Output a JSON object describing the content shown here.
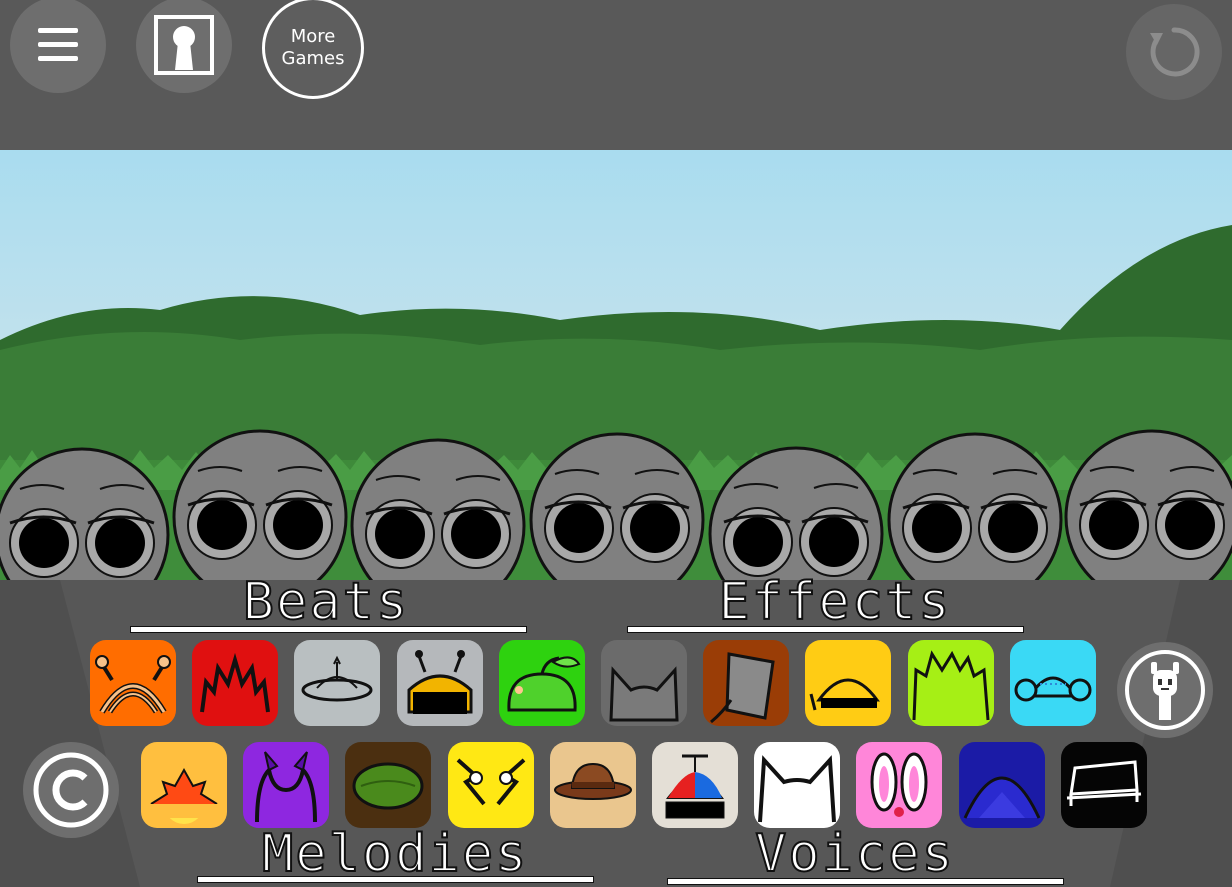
{
  "toolbar": {
    "menu_icon": "hamburger-menu-icon",
    "keyhole_icon": "keyhole-icon",
    "more_games_line1": "More",
    "more_games_line2": "Games",
    "reset_icon": "reset-icon"
  },
  "categories": {
    "beats": "Beats",
    "effects": "Effects",
    "melodies": "Melodies",
    "voices": "Voices"
  },
  "row1_slots": [
    {
      "icon": "orange-antenna-headband-icon",
      "color": "#ff6d00"
    },
    {
      "icon": "red-spiky-hair-icon",
      "color": "#e01010"
    },
    {
      "icon": "grey-ufo-icon",
      "color": "#b9bfc1"
    },
    {
      "icon": "grey-robot-antenna-icon",
      "color": "#b5b8bb"
    },
    {
      "icon": "green-apple-icon",
      "color": "#2ed20f"
    },
    {
      "icon": "grey-cat-ears-icon",
      "color": "#6b6b6b"
    },
    {
      "icon": "bucket-hat-icon",
      "color": "#9a3d06"
    },
    {
      "icon": "yellow-helmet-icon",
      "color": "#ffcc14"
    },
    {
      "icon": "lime-spiky-hair-icon",
      "color": "#a6ef15"
    },
    {
      "icon": "cyan-beanie-icon",
      "color": "#3ad9f5"
    }
  ],
  "row2_slots": [
    {
      "icon": "sunrise-icon",
      "color": "#ffbf3f"
    },
    {
      "icon": "purple-horns-icon",
      "color": "#8e27e0"
    },
    {
      "icon": "olive-hair-icon",
      "color": "#4b2f10"
    },
    {
      "icon": "yellow-lightning-icon",
      "color": "#ffe814"
    },
    {
      "icon": "fedora-hat-icon",
      "color": "#eac68e"
    },
    {
      "icon": "propeller-cap-icon",
      "color": "#e4dfd6"
    },
    {
      "icon": "white-cat-ears-icon",
      "color": "#ffffff"
    },
    {
      "icon": "bunny-ears-icon",
      "color": "#ff86d9"
    },
    {
      "icon": "blue-dome-icon",
      "color": "#1b1ba6"
    },
    {
      "icon": "black-bench-icon",
      "color": "#050505"
    }
  ],
  "copyright_icon": "copyright-icon",
  "character_select_icon": "white-character-icon",
  "characters_count_label": "",
  "colors": {
    "sky_top": "#a9dcef",
    "sky_bottom": "#d5e8ee",
    "grass": "#3e8a3a",
    "character_grey": "#808080"
  }
}
